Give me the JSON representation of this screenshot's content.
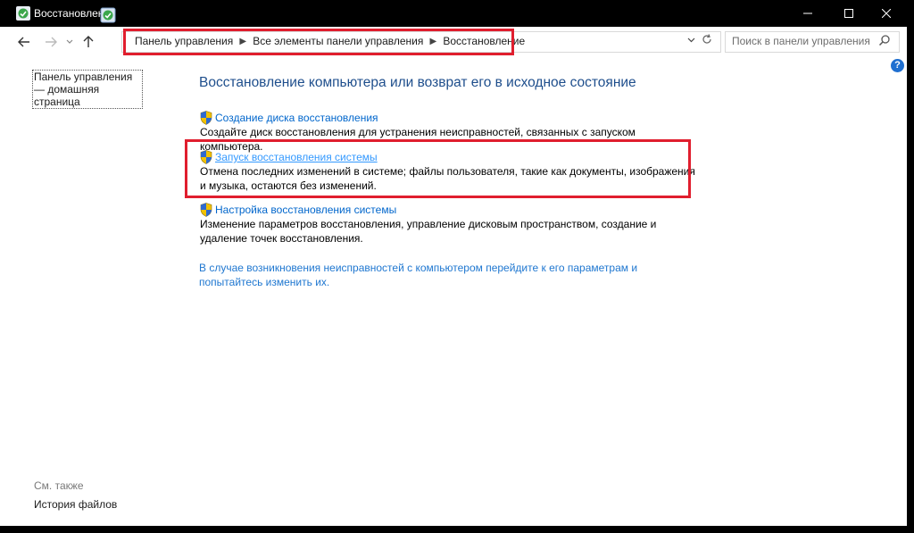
{
  "window": {
    "title": "Восстановление"
  },
  "nav": {
    "breadcrumbs": [
      "Панель управления",
      "Все элементы панели управления",
      "Восстановление"
    ],
    "search_placeholder": "Поиск в панели управления"
  },
  "sidebar": {
    "home_link": "Панель управления — домашняя страница",
    "see_also_label": "См. также",
    "file_history": "История файлов"
  },
  "main": {
    "title": "Восстановление компьютера или возврат его в исходное состояние",
    "items": [
      {
        "link": "Создание диска восстановления",
        "description": "Создайте диск восстановления для устранения неисправностей, связанных с запуском компьютера."
      },
      {
        "link": "Запуск восстановления системы",
        "description": "Отмена последних изменений в системе; файлы пользователя, такие как документы, изображения и музыка, остаются без изменений."
      },
      {
        "link": "Настройка восстановления системы",
        "description": "Изменение параметров восстановления, управление дисковым пространством, создание и удаление точек восстановления."
      }
    ],
    "help_link": "В случае возникновения неисправностей с компьютером перейдите к его параметрам и попытайтесь изменить их."
  },
  "colors": {
    "highlight": "#e01e2e",
    "link": "#0066cc",
    "title": "#1e4e8c"
  }
}
